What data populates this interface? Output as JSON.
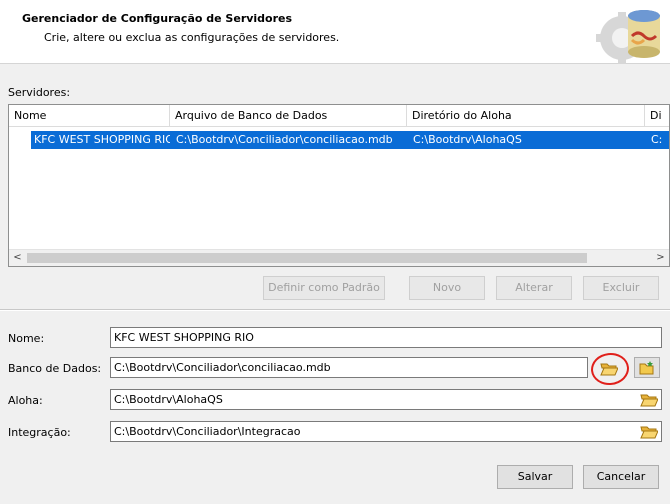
{
  "window": {
    "title": "Gerenciador de Configuração de Servidores",
    "subtitle": "Crie, altere ou exclua as configurações de servidores."
  },
  "servers": {
    "label": "Servidores:",
    "columns": [
      "Nome",
      "Arquivo de Banco de Dados",
      "Diretório do Aloha",
      "Di"
    ],
    "rows": [
      {
        "name": "KFC WEST SHOPPING RIO",
        "db": "C:\\Bootdrv\\Conciliador\\conciliacao.mdb",
        "aloha": "C:\\Bootdrv\\AlohaQS",
        "extra": "C:"
      }
    ]
  },
  "scroll": {
    "left": "<",
    "right": ">"
  },
  "actions": {
    "set_default": "Definir como Padrão",
    "new": "Novo",
    "edit": "Alterar",
    "delete": "Excluir"
  },
  "form": {
    "name_label": "Nome:",
    "name_value": "KFC WEST SHOPPING RIO",
    "db_label": "Banco de Dados:",
    "db_value": "C:\\Bootdrv\\Conciliador\\conciliacao.mdb",
    "aloha_label": "Aloha:",
    "aloha_value": "C:\\Bootdrv\\AlohaQS",
    "integration_label": "Integração:",
    "integration_value": "C:\\Bootdrv\\Conciliador\\Integracao"
  },
  "footer": {
    "save": "Salvar",
    "cancel": "Cancelar"
  },
  "icons": {
    "header": "server-config-icon",
    "browse": "folder-open-icon",
    "new_db": "new-database-icon"
  },
  "colors": {
    "selection": "#0a6cd6",
    "annotation": "#e0201b"
  }
}
